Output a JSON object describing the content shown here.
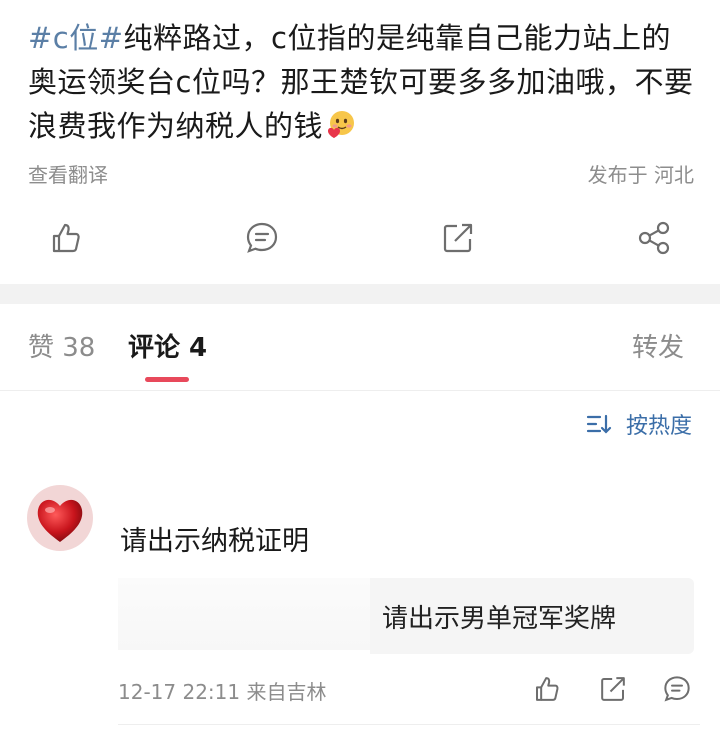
{
  "post": {
    "hashtag": "#c位#",
    "text": "纯粹路过，c位指的是纯靠自己能力站上的奥运领奖台c位吗？那王楚钦可要多多加油哦，不要浪费我作为纳税人的钱",
    "emoji_icon": "hugging-face-emoji"
  },
  "meta": {
    "translate": "查看翻译",
    "location": "发布于 河北"
  },
  "actions": {
    "icons": [
      "thumbs-up-icon",
      "comment-icon",
      "repost-icon",
      "share-icon"
    ]
  },
  "tabs": {
    "likes": "赞 38",
    "comments": "评论 4",
    "reposts": "转发",
    "active_color": "#e8495b"
  },
  "sort": {
    "label": "按热度",
    "icon": "sort-icon",
    "color": "#3b6ea8"
  },
  "comment": {
    "text": "请出示纳税证明",
    "quote": "请出示男单冠军奖牌",
    "time_source": "12-17 22:11  来自吉林",
    "icons": [
      "thumbs-up-icon",
      "repost-icon",
      "comment-icon"
    ]
  }
}
